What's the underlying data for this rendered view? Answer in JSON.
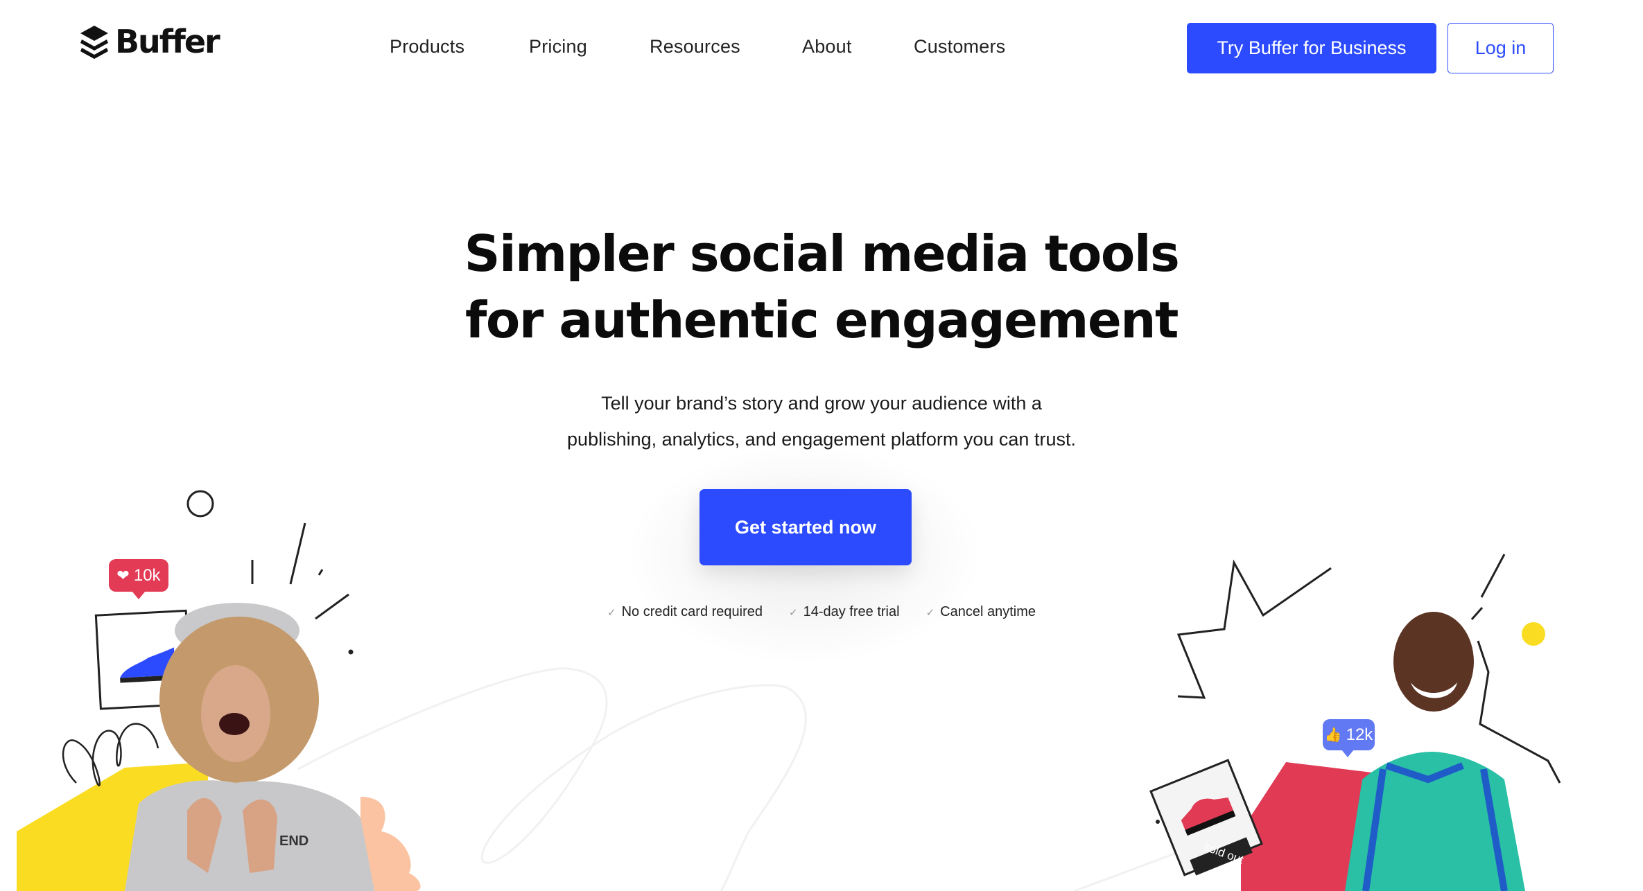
{
  "header": {
    "logo_text": "Buffer",
    "nav": [
      {
        "label": "Products"
      },
      {
        "label": "Pricing"
      },
      {
        "label": "Resources"
      },
      {
        "label": "About"
      },
      {
        "label": "Customers"
      }
    ],
    "business_button": "Try Buffer for Business",
    "login_button": "Log in"
  },
  "hero": {
    "title_line1": "Simpler social media tools",
    "title_line2": "for authentic engagement",
    "subtitle_line1": "Tell your brand’s story and grow your audience with a",
    "subtitle_line2": "publishing, analytics, and engagement platform you can trust.",
    "cta": "Get started now",
    "perks": [
      {
        "label": "No credit card required"
      },
      {
        "label": "14-day free trial"
      },
      {
        "label": "Cancel anytime"
      }
    ]
  },
  "illustrations": {
    "left_badge": {
      "icon": "heart-icon",
      "count": "10k"
    },
    "right_badge": {
      "icon": "thumbs-up-icon",
      "count": "12k"
    },
    "sold_out_label": "sold out",
    "sweatshirt_text": "END"
  },
  "colors": {
    "brand_blue": "#2c4bff",
    "heart_badge_red": "#e33b55",
    "like_badge_blue": "#6279f4",
    "accent_yellow": "#fadd23",
    "accent_peach": "#fbc3a2",
    "accent_red": "#e03a55"
  }
}
